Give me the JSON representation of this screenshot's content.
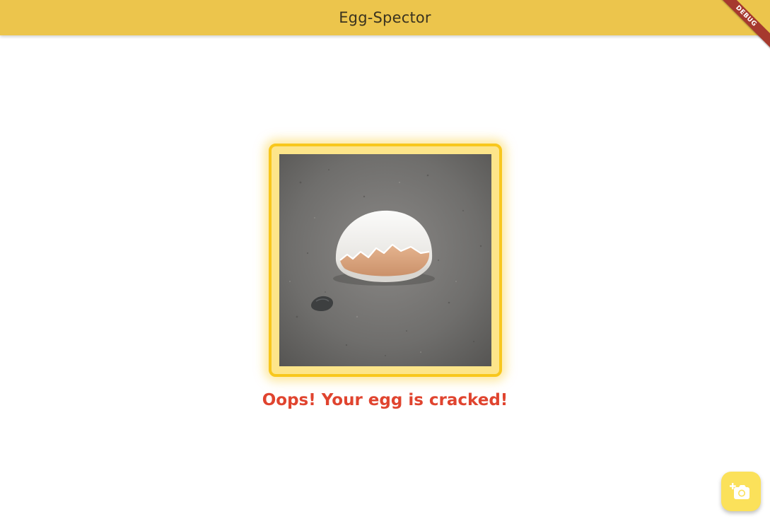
{
  "app_bar": {
    "title": "Egg-Spector",
    "background": "#ecc54c"
  },
  "debug_banner": {
    "label": "DEBUG"
  },
  "photo": {
    "subject": "cracked-egg-shell-on-concrete",
    "frame_color": "#f8c71c"
  },
  "result": {
    "message": "Oops! Your egg is cracked!",
    "color": "#e0442f"
  },
  "fab": {
    "icon": "add-a-photo-icon",
    "background": "#fbe15a"
  }
}
